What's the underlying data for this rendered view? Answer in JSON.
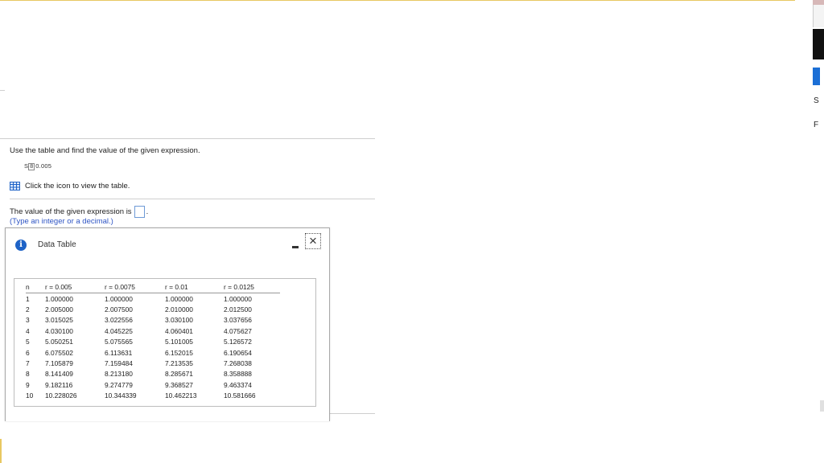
{
  "question": {
    "instruction": "Use the table and find the value of the given expression.",
    "expression": {
      "symbol": "S",
      "subscript": "8",
      "rate": "0.005"
    },
    "table_link": "Click the icon to view the table.",
    "answer_prefix": "The value of the given expression is",
    "answer_suffix": ".",
    "hint": "(Type an integer or a decimal.)"
  },
  "dialog": {
    "title": "Data Table",
    "minimize_label": "-",
    "close_label": "×",
    "columns": [
      "n",
      "r = 0.005",
      "r = 0.0075",
      "r = 0.01",
      "r = 0.0125"
    ],
    "rows": [
      [
        "1",
        "1.000000",
        "1.000000",
        "1.000000",
        "1.000000"
      ],
      [
        "2",
        "2.005000",
        "2.007500",
        "2.010000",
        "2.012500"
      ],
      [
        "3",
        "3.015025",
        "3.022556",
        "3.030100",
        "3.037656"
      ],
      [
        "4",
        "4.030100",
        "4.045225",
        "4.060401",
        "4.075627"
      ],
      [
        "5",
        "5.050251",
        "5.075565",
        "5.101005",
        "5.126572"
      ],
      [
        "6",
        "6.075502",
        "6.113631",
        "6.152015",
        "6.190654"
      ],
      [
        "7",
        "7.105879",
        "7.159484",
        "7.213535",
        "7.268038"
      ],
      [
        "8",
        "8.141409",
        "8.213180",
        "8.285671",
        "8.358888"
      ],
      [
        "9",
        "9.182116",
        "9.274779",
        "9.368527",
        "9.463374"
      ],
      [
        "10",
        "10.228026",
        "10.344339",
        "10.462213",
        "10.581666"
      ]
    ]
  },
  "sidebar_fragment": {
    "letters": [
      "S",
      "F"
    ]
  },
  "colors": {
    "accent_blue": "#1e63c7",
    "hint_blue": "#2f55c4",
    "top_rule": "#e8c862"
  }
}
